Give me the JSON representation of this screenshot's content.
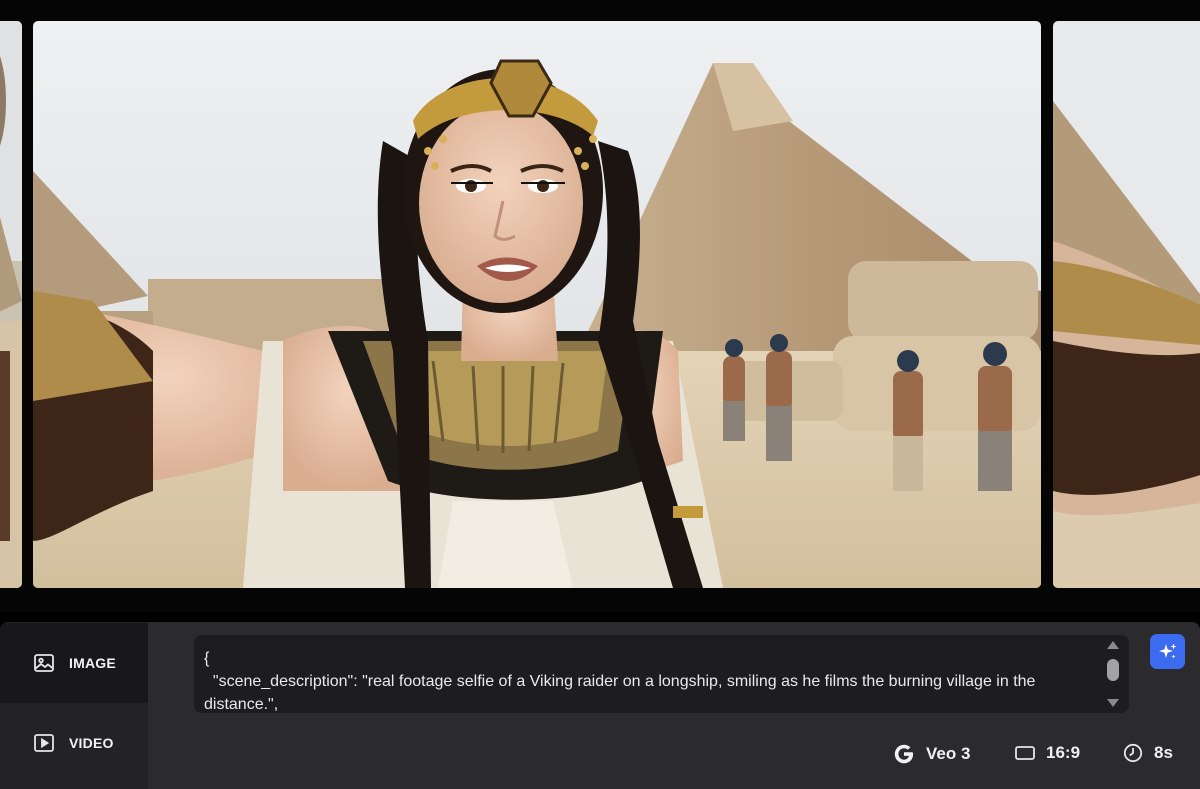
{
  "modes": [
    {
      "label": "IMAGE",
      "icon": "image-icon",
      "selected": true
    },
    {
      "label": "VIDEO",
      "icon": "video-icon",
      "selected": false
    }
  ],
  "prompt": {
    "text": "{\n  \"scene_description\": \"real footage selfie of a Viking raider on a longship, smiling as he films the burning village in the distance.\","
  },
  "settings": {
    "model": "Veo 3",
    "aspect_ratio": "16:9",
    "duration": "8s"
  },
  "colors": {
    "accent": "#3d6bf0",
    "panel": "#2b2b2d",
    "selected_mode": "#18181a"
  }
}
